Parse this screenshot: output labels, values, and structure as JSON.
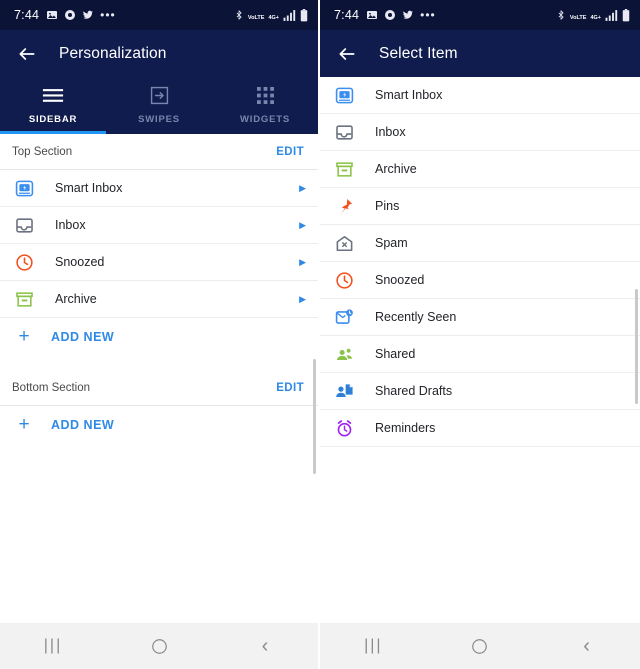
{
  "status_bar": {
    "time": "7:44",
    "left_icons": [
      "photos-icon",
      "camera-icon",
      "twitter-icon",
      "more-dots-icon"
    ],
    "right_icons": [
      "bluetooth-icon",
      "volte-icon",
      "4g-plus-icon",
      "signal-bars-icon",
      "battery-icon"
    ],
    "volte_label": "VoLTE",
    "network_label": "4G+"
  },
  "left_panel": {
    "appbar": {
      "back_icon": "back-arrow-icon",
      "title": "Personalization"
    },
    "tabs": [
      {
        "label": "SIDEBAR",
        "icon": "hamburger-icon",
        "active": true
      },
      {
        "label": "SWIPES",
        "icon": "arrow-in-box-icon",
        "active": false
      },
      {
        "label": "WIDGETS",
        "icon": "grid-dots-icon",
        "active": false
      }
    ],
    "sections": [
      {
        "title": "Top Section",
        "edit_label": "EDIT",
        "rows": [
          {
            "label": "Smart Inbox",
            "icon": "smart-inbox-icon",
            "chevron": "▶"
          },
          {
            "label": "Inbox",
            "icon": "inbox-icon",
            "chevron": "▶"
          },
          {
            "label": "Snoozed",
            "icon": "snoozed-clock-icon",
            "chevron": "▶"
          },
          {
            "label": "Archive",
            "icon": "archive-box-icon",
            "chevron": "▶"
          }
        ],
        "add_new_label": "ADD NEW"
      },
      {
        "title": "Bottom Section",
        "edit_label": "EDIT",
        "rows": [],
        "add_new_label": "ADD NEW"
      }
    ]
  },
  "right_panel": {
    "appbar": {
      "back_icon": "back-arrow-icon",
      "title": "Select Item"
    },
    "items": [
      {
        "label": "Smart Inbox",
        "icon": "smart-inbox-icon"
      },
      {
        "label": "Inbox",
        "icon": "inbox-icon"
      },
      {
        "label": "Archive",
        "icon": "archive-box-icon"
      },
      {
        "label": "Pins",
        "icon": "pin-icon"
      },
      {
        "label": "Spam",
        "icon": "spam-icon"
      },
      {
        "label": "Snoozed",
        "icon": "snoozed-clock-icon"
      },
      {
        "label": "Recently Seen",
        "icon": "recently-seen-icon"
      },
      {
        "label": "Shared",
        "icon": "shared-people-icon"
      },
      {
        "label": "Shared Drafts",
        "icon": "shared-drafts-icon"
      },
      {
        "label": "Reminders",
        "icon": "reminders-alarm-icon"
      }
    ]
  },
  "nav_bar": {
    "recents_label": "|||",
    "home_icon": "home-circle-icon",
    "back_label": "‹"
  },
  "colors": {
    "status_bar_bg": "#0b1337",
    "app_bar_bg": "#111c4e",
    "accent_blue": "#2f8ae6",
    "tab_indicator": "#2196f3",
    "icon_blue": "#3b8ef0",
    "icon_green": "#8bc34a",
    "icon_orange": "#f4511e",
    "icon_purple": "#a020f0",
    "icon_gray": "#6b7280"
  }
}
